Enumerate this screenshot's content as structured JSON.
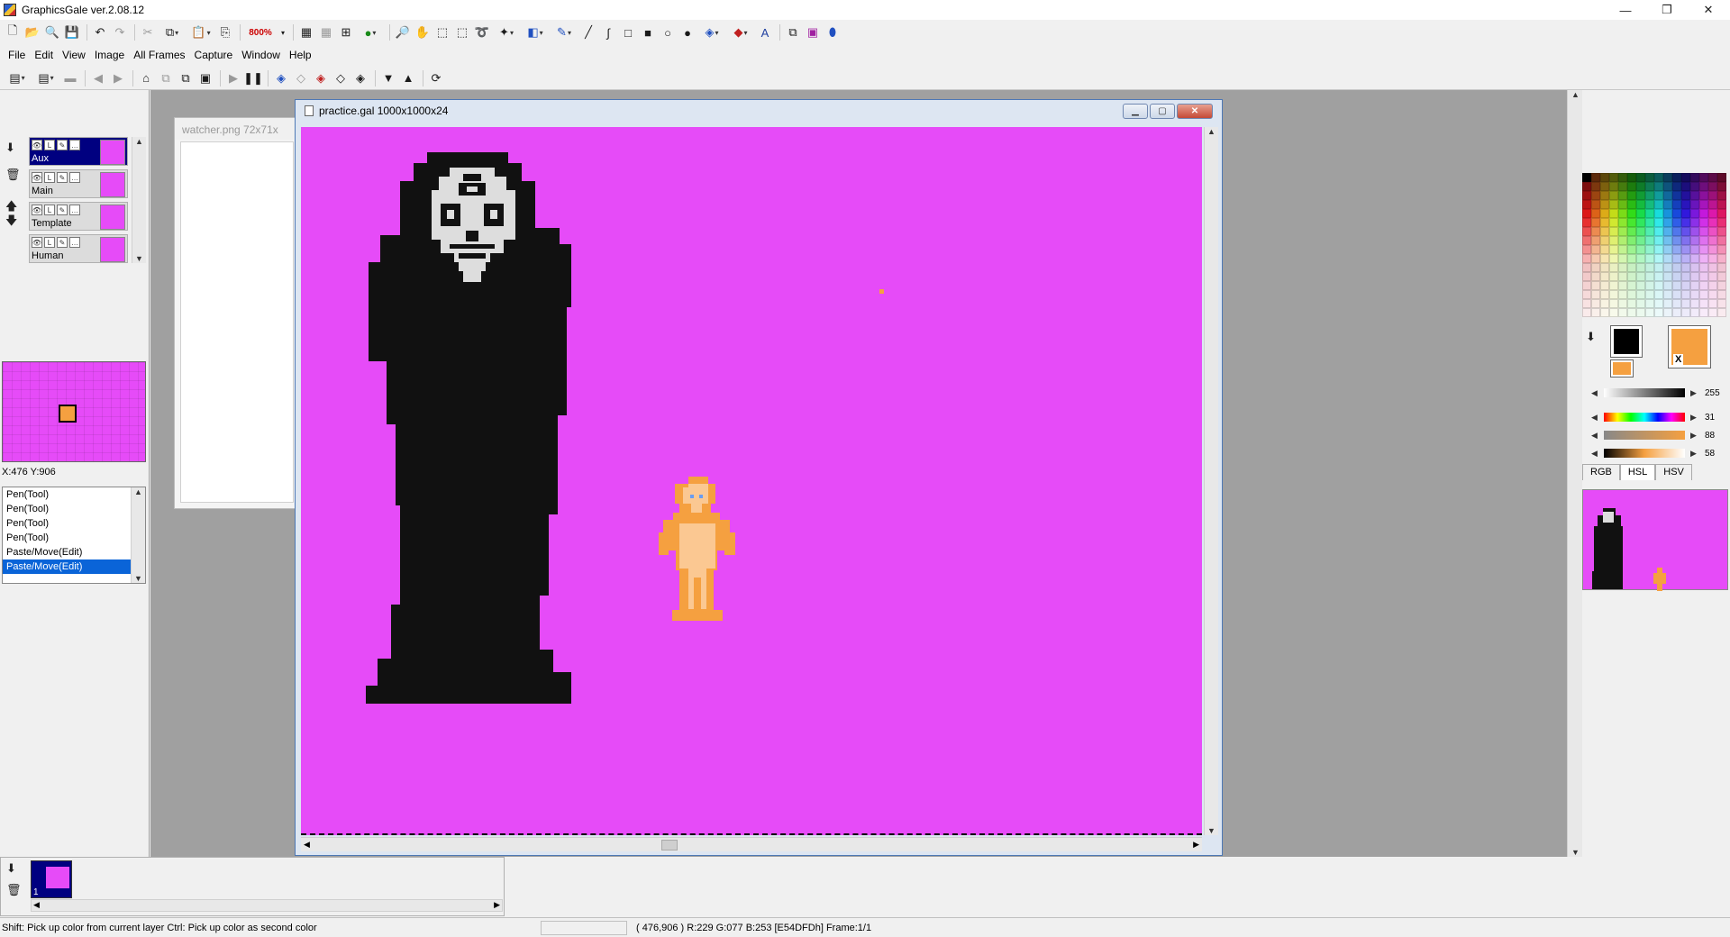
{
  "app": {
    "title": "GraphicsGale ver.2.08.12"
  },
  "menu": [
    "File",
    "Edit",
    "View",
    "Image",
    "All Frames",
    "Capture",
    "Window",
    "Help"
  ],
  "toolbar": {
    "zoom_value": "800%"
  },
  "layers": [
    {
      "name": "Aux",
      "selected": true
    },
    {
      "name": "Main",
      "selected": false
    },
    {
      "name": "Template",
      "selected": false
    },
    {
      "name": "Human",
      "selected": false
    }
  ],
  "navigator": {
    "coords": "X:476 Y:906"
  },
  "history": [
    {
      "label": "Pen(Tool)",
      "selected": false
    },
    {
      "label": "Pen(Tool)",
      "selected": false
    },
    {
      "label": "Pen(Tool)",
      "selected": false
    },
    {
      "label": "Pen(Tool)",
      "selected": false
    },
    {
      "label": "Paste/Move(Edit)",
      "selected": false
    },
    {
      "label": "Paste/Move(Edit)",
      "selected": true
    }
  ],
  "background_window": {
    "title": "watcher.png 72x71x"
  },
  "document": {
    "title": "practice.gal 1000x1000x24",
    "canvas_color": "#e64bf8"
  },
  "colors": {
    "foreground": "#000000",
    "background": "#f5a040",
    "x_label": "X"
  },
  "sliders": [
    {
      "value": "255"
    },
    {
      "value": "31"
    },
    {
      "value": "88"
    },
    {
      "value": "58"
    }
  ],
  "color_tabs": [
    {
      "label": "RGB",
      "active": false
    },
    {
      "label": "HSL",
      "active": true
    },
    {
      "label": "HSV",
      "active": false
    }
  ],
  "frames": {
    "count_label": "1"
  },
  "status": {
    "hint": "Shift: Pick up color from current layer  Ctrl: Pick up color as second color",
    "pixel_info": "( 476,906 ) R:229 G:077 B:253  [E54DFDh]  Frame:1/1"
  }
}
